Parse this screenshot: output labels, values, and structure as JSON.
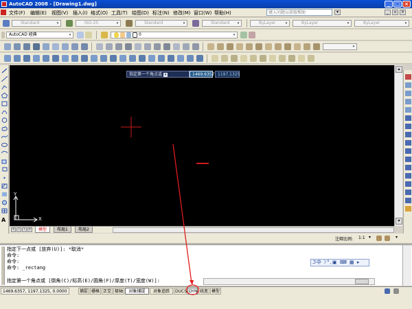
{
  "window": {
    "title": "AutoCAD 2008 - [Drawing1.dwg]",
    "controls": [
      "_",
      "□",
      "×"
    ]
  },
  "menu": {
    "items": [
      "文件(F)",
      "编辑(E)",
      "视图(V)",
      "插入(I)",
      "格式(O)",
      "工具(T)",
      "绘图(D)",
      "标注(N)",
      "修改(M)",
      "窗口(W)",
      "帮助(H)"
    ],
    "help_placeholder": "键入问题以获取帮助"
  },
  "toolbar_styles": {
    "text_style": "Standard",
    "dim_style": "ISO-25",
    "table_style": "Standard",
    "multileader_style": "Standard",
    "color": "ByLayer",
    "linetype": "ByLayer",
    "lineweight": "ByLayer"
  },
  "workspace": {
    "name": "AutoCAD 经典",
    "layer": "0"
  },
  "canvas": {
    "prompt": "指定第一个角点或",
    "x_value": "1469.6357",
    "y_value": "1197.1325",
    "ucs_x": "X",
    "ucs_y": "Y"
  },
  "layout_tabs": [
    "模型",
    "布局1",
    "布局2"
  ],
  "annotation": {
    "label": "注释比例:",
    "scale": "1:1"
  },
  "command": {
    "lines": [
      "指定下一点或 [放弃(U)]: *取消*",
      "命令:",
      "命令:",
      "命令: _rectang",
      "指定第一个角点或 [倒角(C)/标高(E)/圆角(F)/厚度(T)/宽度(W)]:"
    ],
    "ime_bar": "ℑ中☽°,▣ ⌨ ▦ ▸"
  },
  "status": {
    "coords": "1469.6357, 1197.1325, 0.0000",
    "toggles": [
      "捕捉",
      "栅格",
      "正交",
      "极轴",
      "对象捕捉",
      "对象追踪",
      "DUCS",
      "DYN",
      "线宽",
      "模型"
    ]
  },
  "colors": {
    "title_bar": "#0a47c4",
    "canvas_bg": "#000000",
    "crosshair": "#d11a1a",
    "annotation_arrow": "#e01b1b"
  }
}
